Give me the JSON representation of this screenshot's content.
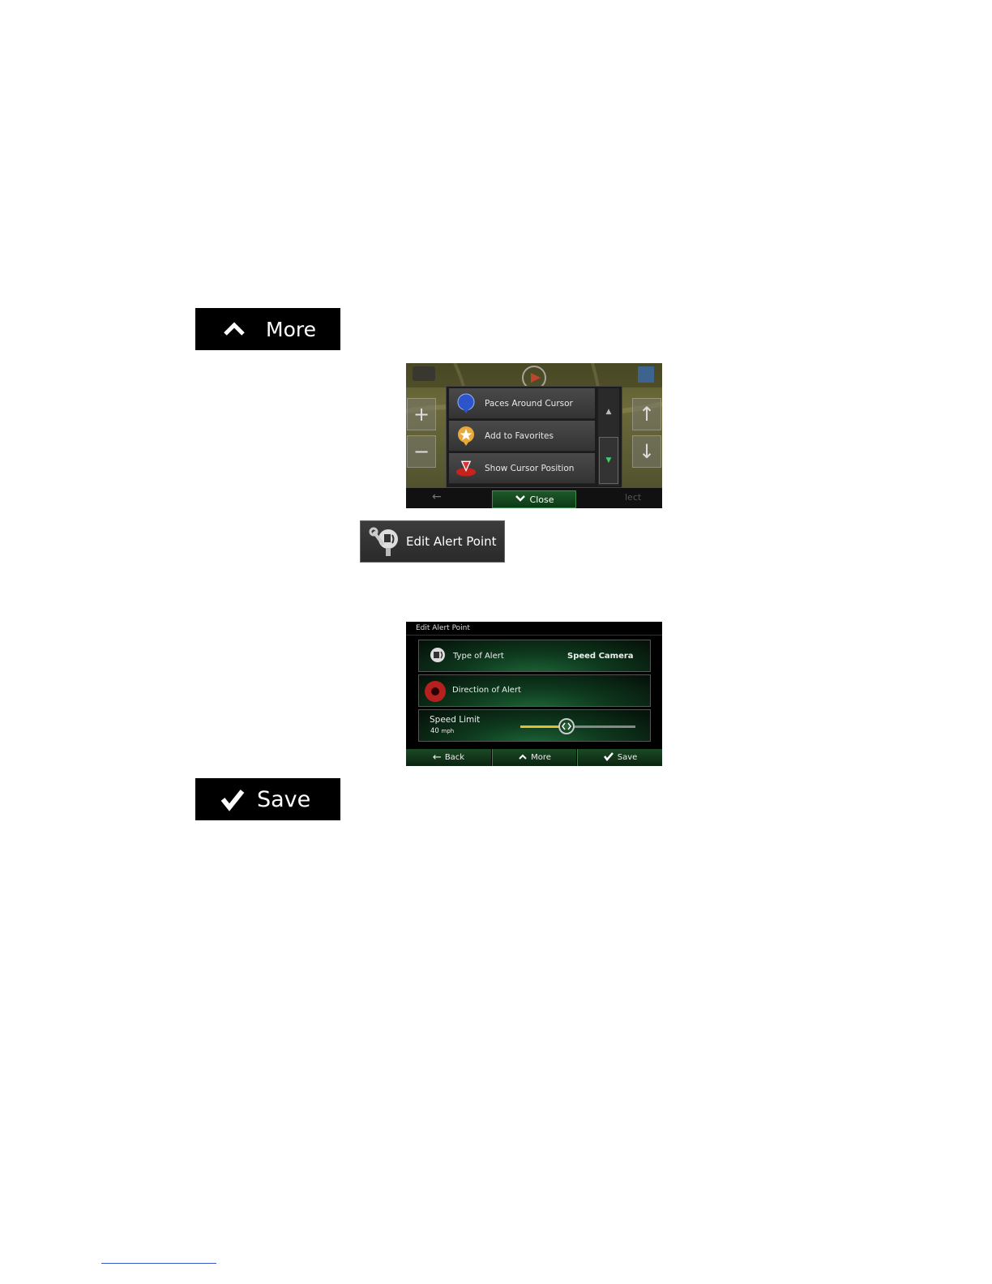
{
  "more_button": {
    "label": "More",
    "icon": "chevron-up-icon"
  },
  "map_screen": {
    "menu_items": [
      {
        "label": "Paces Around Cursor",
        "icon": "blue-pin-icon"
      },
      {
        "label": "Add to Favorites",
        "icon": "star-pin-icon"
      },
      {
        "label": "Show Cursor Position",
        "icon": "cursor-position-icon"
      }
    ],
    "close_label": "Close",
    "bottom_right_text": "lect"
  },
  "edit_alert_button": {
    "label": "Edit Alert Point",
    "icon": "alert-edit-icon"
  },
  "alert_screen": {
    "title": "Edit Alert Point",
    "type_label": "Type of Alert",
    "type_value": "Speed Camera",
    "direction_label": "Direction of Alert",
    "speed_label": "Speed Limit",
    "speed_value": "40",
    "speed_unit": "mph",
    "speed_slider_fraction": 0.4,
    "tabs": {
      "back": "Back",
      "more": "More",
      "save": "Save"
    }
  },
  "save_button": {
    "label": "Save",
    "icon": "checkmark-icon"
  },
  "colors": {
    "accent_green": "#2e7d3a",
    "slider_yellow": "#e0c030"
  }
}
